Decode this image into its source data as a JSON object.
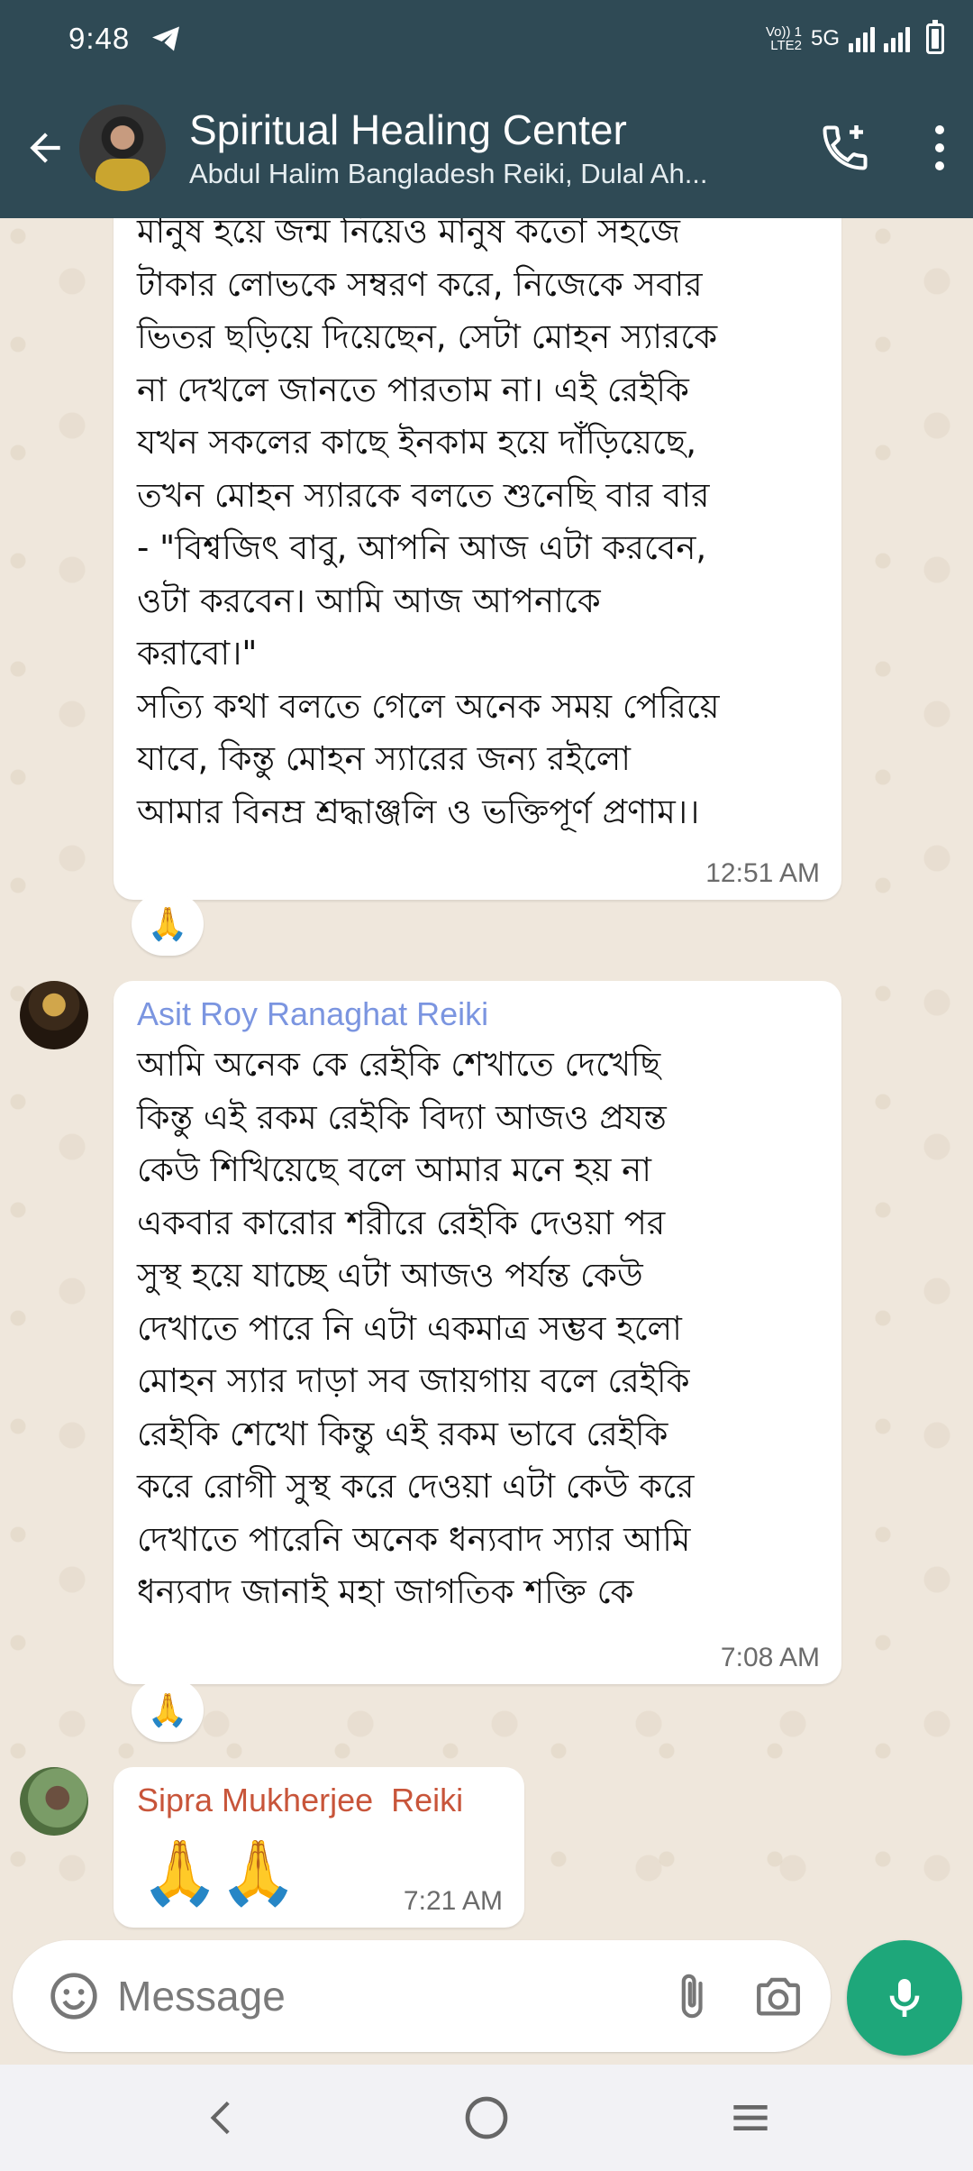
{
  "status_bar": {
    "time": "9:48",
    "network_label": "5G",
    "volte_label_top": "Vo)) 1",
    "volte_label_bottom": "LTE2"
  },
  "header": {
    "title": "Spiritual Healing Center",
    "subtitle": "Abdul Halim Bangladesh Reiki, Dulal Ah..."
  },
  "messages": [
    {
      "text": "মানুষ হয়ে জন্ম নিয়েও মানুষ কতো সহজে\nটাকার লোভকে সম্বরণ করে, নিজেকে সবার\nভিতর ছড়িয়ে দিয়েছেন, সেটা মোহন স্যারকে\nনা দেখলে জানতে পারতাম না। এই রেইকি\nযখন সকলের কাছে ইনকাম হয়ে দাঁড়িয়েছে,\nতখন মোহন স্যারকে বলতে শুনেছি বার বার\n- \"বিশ্বজিৎ বাবু, আপনি আজ এটা করবেন,\nওটা করবেন। আমি আজ আপনাকে\nকরাবো।\"\nসত্যি কথা বলতে গেলে অনেক সময় পেরিয়ে\nযাবে, কিন্তু মোহন স্যারের জন্য রইলো\nআমার বিনম্র শ্রদ্ধাঞ্জলি ও ভক্তিপূর্ণ প্রণাম।।",
      "time": "12:51 AM",
      "reaction": "🙏"
    },
    {
      "sender": "Asit Roy Ranaghat Reiki",
      "sender_color": "#7b95e0",
      "text": "আমি অনেক কে রেইকি শেখাতে দেখেছি\nকিন্তু এই রকম রেইকি বিদ্যা আজও প্রযন্ত\nকেউ শিখিয়েছে বলে আমার মনে হয় না\nএকবার কারোর শরীরে রেইকি দেওয়া পর\nসুস্থ হয়ে যাচ্ছে এটা আজও পর্যন্ত কেউ\nদেখাতে পারে নি এটা একমাত্র সম্ভব হলো\nমোহন স্যার দাড়া সব জায়গায় বলে রেইকি\nরেইকি শেখো কিন্তু এই রকম ভাবে রেইকি\nকরে রোগী সুস্থ করে দেওয়া এটা কেউ করে\nদেখাতে পারেনি অনেক ধন্যবাদ স্যার আমি\nধন্যবাদ জানাই মহা জাগতিক শক্তি কে",
      "time": "7:08 AM",
      "reaction": "🙏"
    },
    {
      "sender": "Sipra Mukherjee  Reiki",
      "sender_color": "#c8553a",
      "text": "🙏🙏",
      "time": "7:21 AM"
    }
  ],
  "input": {
    "placeholder": "Message"
  },
  "colors": {
    "header_bg": "#2f4a55",
    "mic_bg": "#1ea77a",
    "chat_bg": "#efe7dc"
  },
  "icons": [
    "back-arrow-icon",
    "add-call-icon",
    "more-vert-icon",
    "emoji-icon",
    "attach-icon",
    "camera-icon",
    "mic-icon",
    "nav-back-icon",
    "nav-home-icon",
    "nav-recents-icon"
  ]
}
